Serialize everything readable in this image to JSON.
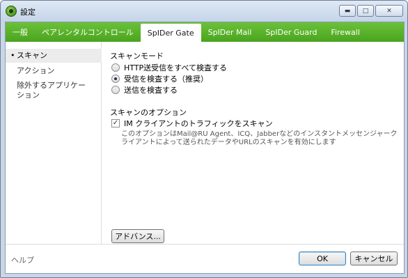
{
  "window": {
    "title": "設定",
    "app_icon": "spider-logo-icon"
  },
  "window_controls": {
    "minimize": "▬",
    "maximize": "□",
    "close": "✕"
  },
  "tabs": [
    {
      "label": "一般"
    },
    {
      "label": "ペアレンタルコントロール"
    },
    {
      "label": "SpIDer Gate",
      "active": true
    },
    {
      "label": "SpIDer Mail"
    },
    {
      "label": "SpIDer Guard"
    },
    {
      "label": "Firewall"
    }
  ],
  "sidebar": {
    "items": [
      {
        "label": "スキャン",
        "bullet": "•",
        "active": true
      },
      {
        "label": "アクション"
      },
      {
        "label": "除外するアプリケーション"
      }
    ]
  },
  "scan_mode": {
    "heading": "スキャンモード",
    "options": [
      {
        "label": "HTTP送受信をすべて検査する",
        "checked": false
      },
      {
        "label": "受信を検査する（推奨）",
        "checked": true
      },
      {
        "label": "送信を検査する",
        "checked": false
      }
    ]
  },
  "scan_options": {
    "heading": "スキャンのオプション",
    "im_checkbox": {
      "label": "IM クライアントのトラフィックをスキャン",
      "checked": true,
      "mark": "✓"
    },
    "description": "このオプションはMail@RU Agent、ICQ、Jabberなどのインスタントメッセンジャークライアントによって送られたデータやURLのスキャンを有効にします"
  },
  "advanced_button": "アドバンス...",
  "footer": {
    "help": "ヘルプ",
    "ok": "OK",
    "cancel": "キャンセル"
  },
  "colors": {
    "tab_bar_green": "#49a41d",
    "title_bar": "#c4d4e8"
  }
}
